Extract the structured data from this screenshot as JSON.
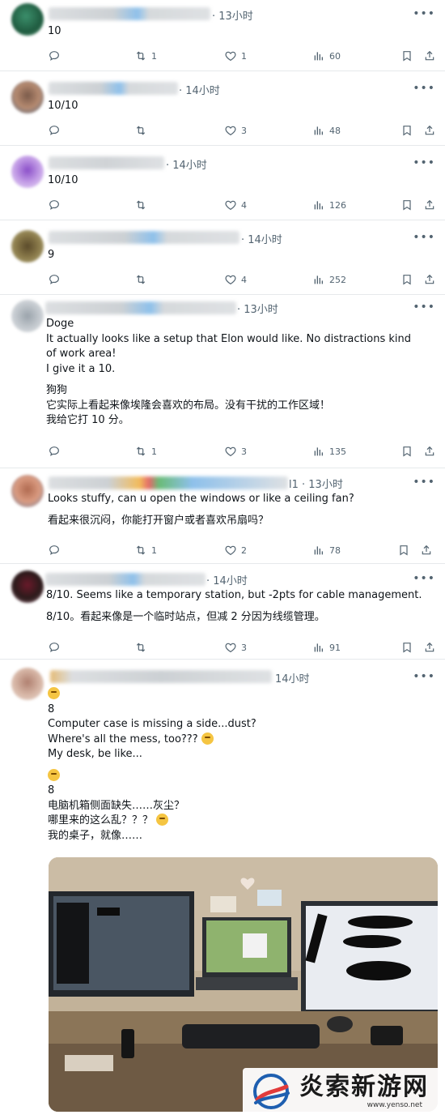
{
  "replies": [
    {
      "time": "· 13小时",
      "lines": [
        "10"
      ],
      "reply_count": "",
      "repost_count": "1",
      "like_count": "1",
      "view_count": "60"
    },
    {
      "time": "· 14小时",
      "lines": [
        "10/10"
      ],
      "reply_count": "",
      "repost_count": "",
      "like_count": "3",
      "view_count": "48"
    },
    {
      "time": "· 14小时",
      "lines": [
        "10/10"
      ],
      "reply_count": "",
      "repost_count": "",
      "like_count": "4",
      "view_count": "126"
    },
    {
      "time": "· 14小时",
      "lines": [
        "9"
      ],
      "reply_count": "",
      "repost_count": "",
      "like_count": "4",
      "view_count": "252"
    },
    {
      "time": "· 13小时",
      "lines": [
        "Doge",
        "It actually looks like a setup that Elon would like. No distractions kind of work area!",
        "I give it a 10.",
        "狗狗",
        "它实际上看起来像埃隆会喜欢的布局。没有干扰的工作区域！",
        "我给它打 10 分。"
      ],
      "reply_count": "",
      "repost_count": "1",
      "like_count": "3",
      "view_count": "135"
    },
    {
      "time": "l1 · 13小时",
      "lines": [
        "Looks stuffy, can u open the windows or like a ceiling fan?",
        "看起来很沉闷，你能打开窗户或者喜欢吊扇吗？"
      ],
      "reply_count": "",
      "repost_count": "1",
      "like_count": "2",
      "view_count": "78"
    },
    {
      "time": "· 14小时",
      "lines": [
        "8/10. Seems like a temporary station, but -2pts for cable management.",
        "8/10。看起来像是一个临时站点，但减 2 分因为线缆管理。"
      ],
      "reply_count": "",
      "repost_count": "",
      "like_count": "3",
      "view_count": "91"
    },
    {
      "time": "14小时",
      "lines": [
        "8",
        "Computer case is missing a side...dust?",
        "Where's all the mess, too???",
        "My desk, be like...",
        "8",
        "电脑机箱侧面缺失……灰尘？",
        "哪里来的这么乱？？？",
        "我的桌子，就像……"
      ]
    }
  ],
  "watermark": {
    "brand": "炎索新游网",
    "url": "www.yenso.net"
  },
  "colors": {
    "text": "#0f1419",
    "muted": "#536471",
    "divider": "#e6e9eb",
    "link_blur": "#7bb6e8"
  }
}
